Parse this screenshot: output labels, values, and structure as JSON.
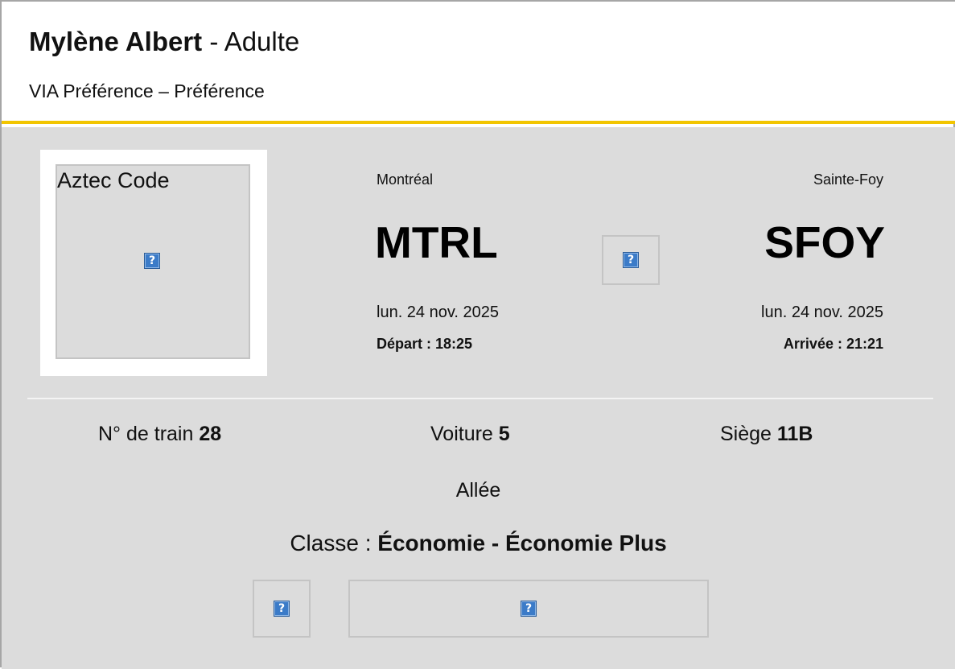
{
  "passenger": {
    "name": "Mylène Albert",
    "separator": " - ",
    "type": "Adulte",
    "program": "VIA Préférence – Préférence"
  },
  "barcode": {
    "label": "Aztec Code",
    "icon": "broken-image-icon"
  },
  "trip": {
    "origin": {
      "city": "Montréal",
      "code": "MTRL",
      "date": "lun. 24 nov. 2025",
      "time_label": "Départ : 18:25"
    },
    "destination": {
      "city": "Sainte-Foy",
      "code": "SFOY",
      "date": "lun. 24 nov. 2025",
      "time_label": "Arrivée : 21:21"
    },
    "arrow_icon": "broken-image-icon"
  },
  "details": {
    "train_label": "N° de train ",
    "train_number": "28",
    "car_label": "Voiture ",
    "car_number": "5",
    "seat_label": "Siège ",
    "seat_number": "11B",
    "seat_type": "Allée",
    "class_label": "Classe : ",
    "class_value": "Économie - Économie Plus"
  },
  "icons": {
    "placeholder_glyph": "?"
  },
  "colors": {
    "accent": "#f2c500",
    "body_background": "#dcdcdc",
    "border": "#a6a6a6"
  }
}
